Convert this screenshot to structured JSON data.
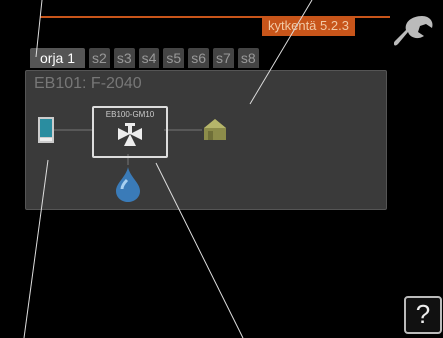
{
  "header": {
    "title": "kytkentä 5.2.3",
    "wrench_icon": "wrench-icon"
  },
  "tabs": [
    {
      "label": "orja 1",
      "active": true
    },
    {
      "label": "s2",
      "active": false
    },
    {
      "label": "s3",
      "active": false
    },
    {
      "label": "s4",
      "active": false
    },
    {
      "label": "s5",
      "active": false
    },
    {
      "label": "s6",
      "active": false
    },
    {
      "label": "s7",
      "active": false
    },
    {
      "label": "s8",
      "active": false
    }
  ],
  "panel": {
    "title": "EB101: F-2040",
    "unit_label": "EB100-GM10"
  },
  "help": {
    "label": "?"
  }
}
